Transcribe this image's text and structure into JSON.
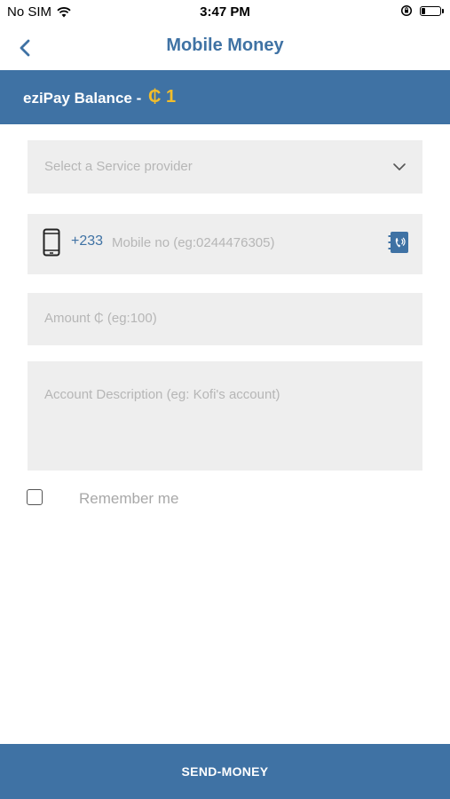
{
  "status_bar": {
    "carrier": "No SIM",
    "time": "3:47 PM"
  },
  "nav": {
    "title": "Mobile Money"
  },
  "balance": {
    "label": "eziPay Balance -",
    "value": "₵ 1"
  },
  "form": {
    "service_provider_placeholder": "Select a Service provider",
    "country_code": "+233",
    "mobile_placeholder": "Mobile no (eg:0244476305)",
    "amount_placeholder": "Amount ₵ (eg:100)",
    "description_placeholder": "Account Description (eg: Kofi's account)"
  },
  "remember": {
    "label": "Remember me",
    "checked": false
  },
  "actions": {
    "send_label": "SEND-MONEY"
  },
  "colors": {
    "brand": "#3f72a4",
    "balance_value": "#f2bd2b",
    "field_bg": "#eeeeee",
    "placeholder": "#b6b6b6"
  },
  "icons": [
    "wifi-icon",
    "orientation-lock-icon",
    "battery-icon",
    "back-chevron-icon",
    "chevron-down-icon",
    "phone-icon",
    "contact-book-icon"
  ]
}
